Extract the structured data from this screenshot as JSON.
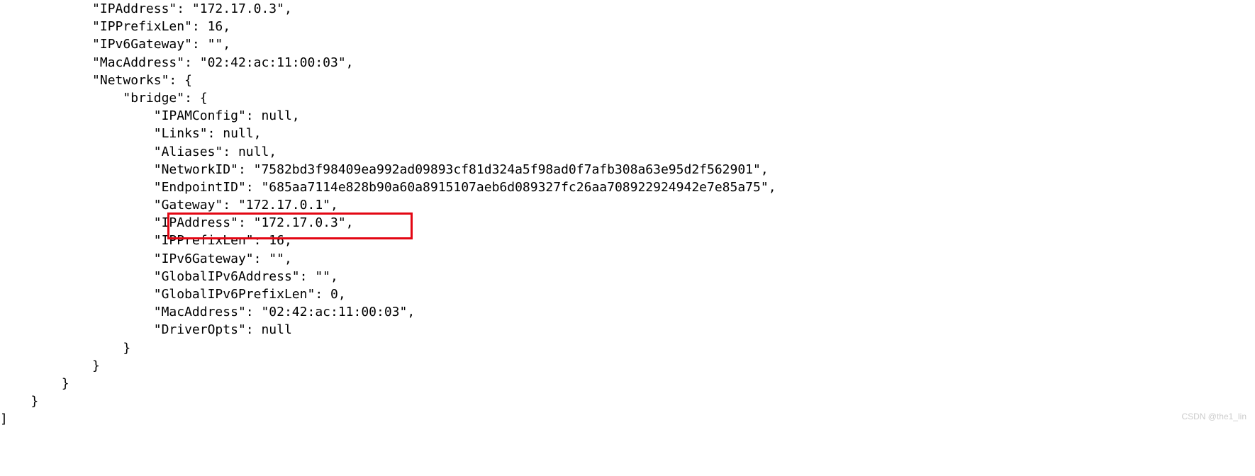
{
  "code": {
    "l0": "            \"GlobalIPv6PrefixLen\": 0,",
    "l1": "            \"IPAddress\": \"172.17.0.3\",",
    "l2": "            \"IPPrefixLen\": 16,",
    "l3": "            \"IPv6Gateway\": \"\",",
    "l4": "            \"MacAddress\": \"02:42:ac:11:00:03\",",
    "l5": "            \"Networks\": {",
    "l6": "                \"bridge\": {",
    "l7": "                    \"IPAMConfig\": null,",
    "l8": "                    \"Links\": null,",
    "l9": "                    \"Aliases\": null,",
    "l10": "                    \"NetworkID\": \"7582bd3f98409ea992ad09893cf81d324a5f98ad0f7afb308a63e95d2f562901\",",
    "l11": "                    \"EndpointID\": \"685aa7114e828b90a60a8915107aeb6d089327fc26aa708922924942e7e85a75\",",
    "l12": "                    \"Gateway\": \"172.17.0.1\",",
    "l13": "                    \"IPAddress\": \"172.17.0.3\",",
    "l14": "                    \"IPPrefixLen\": 16,",
    "l15": "                    \"IPv6Gateway\": \"\",",
    "l16": "                    \"GlobalIPv6Address\": \"\",",
    "l17": "                    \"GlobalIPv6PrefixLen\": 0,",
    "l18": "                    \"MacAddress\": \"02:42:ac:11:00:03\",",
    "l19": "                    \"DriverOpts\": null",
    "l20": "                }",
    "l21": "            }",
    "l22": "        }",
    "l23": "    }",
    "l24": "]"
  },
  "watermark": "CSDN @the1_lin"
}
